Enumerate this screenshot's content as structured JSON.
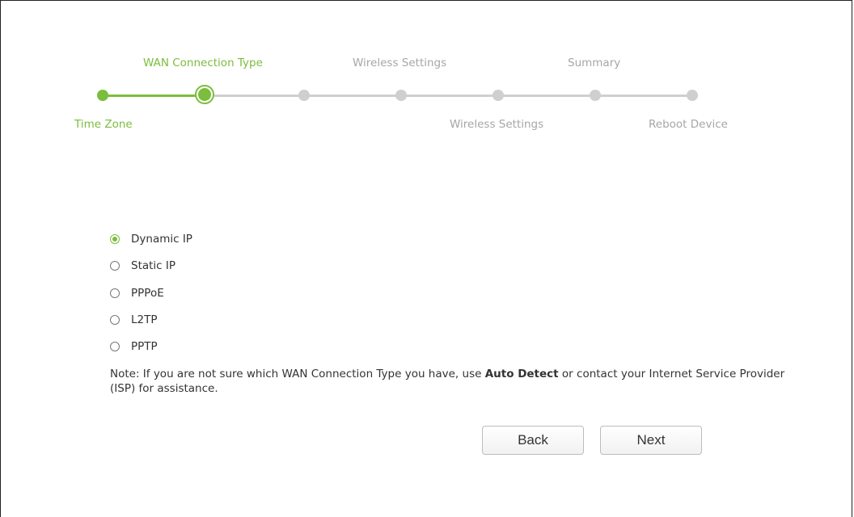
{
  "wizard": {
    "steps_top": [
      "WAN Connection Type",
      "Wireless Settings",
      "Summary"
    ],
    "steps_bottom": [
      "Time Zone",
      "Wireless Settings",
      "Reboot Device"
    ],
    "active_color": "#7bbd3c",
    "inactive_color": "#cfcfcf"
  },
  "connection_types": {
    "options": [
      "Dynamic IP",
      "Static IP",
      "PPPoE",
      "L2TP",
      "PPTP"
    ],
    "selected": "Dynamic IP"
  },
  "note": {
    "prefix": "Note: If you are not sure which WAN Connection Type you have, use ",
    "bold": "Auto Detect",
    "suffix": " or contact your Internet Service Provider (ISP) for assistance."
  },
  "buttons": {
    "back": "Back",
    "next": "Next"
  }
}
